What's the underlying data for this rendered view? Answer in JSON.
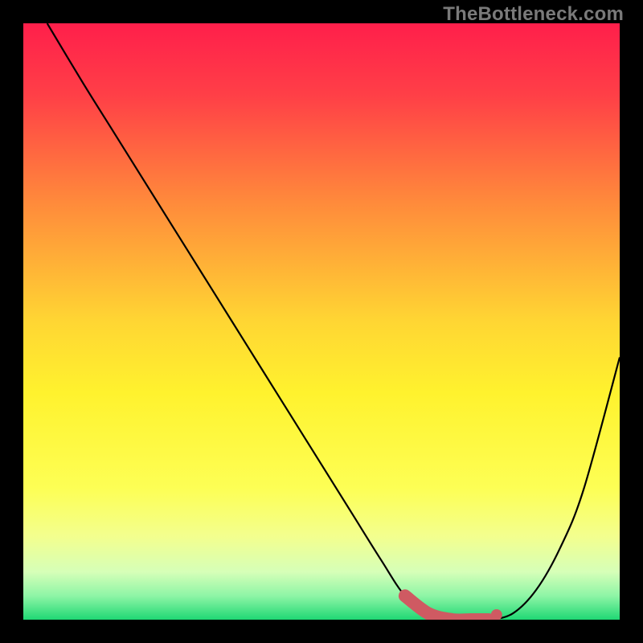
{
  "watermark": "TheBottleneck.com",
  "chart_data": {
    "type": "line",
    "title": "",
    "xlabel": "",
    "ylabel": "",
    "xlim": [
      0,
      100
    ],
    "ylim": [
      0,
      100
    ],
    "grid": false,
    "series": [
      {
        "name": "bottleneck-curve",
        "x": [
          4,
          10,
          15,
          20,
          25,
          30,
          35,
          40,
          45,
          50,
          55,
          60,
          64,
          68,
          72,
          75,
          78,
          82,
          86,
          90,
          94,
          100
        ],
        "y": [
          100,
          90,
          82,
          74,
          66,
          58,
          50,
          42,
          34,
          26,
          18,
          10,
          4,
          1,
          0,
          0,
          0,
          1,
          5,
          12,
          22,
          44
        ]
      }
    ],
    "annotations": [
      {
        "name": "optimal-range-marker",
        "x_start": 62,
        "x_end": 80,
        "style": "thick-red-line"
      }
    ],
    "background": {
      "type": "vertical-gradient",
      "stops": [
        {
          "pos": 0.0,
          "color": "#ff1f4b"
        },
        {
          "pos": 0.12,
          "color": "#ff3f47"
        },
        {
          "pos": 0.3,
          "color": "#ff8a3b"
        },
        {
          "pos": 0.5,
          "color": "#ffd633"
        },
        {
          "pos": 0.62,
          "color": "#fff22e"
        },
        {
          "pos": 0.78,
          "color": "#fdff55"
        },
        {
          "pos": 0.86,
          "color": "#f3ff8e"
        },
        {
          "pos": 0.92,
          "color": "#d6ffb8"
        },
        {
          "pos": 0.96,
          "color": "#8ef5a6"
        },
        {
          "pos": 1.0,
          "color": "#1fd874"
        }
      ]
    }
  }
}
